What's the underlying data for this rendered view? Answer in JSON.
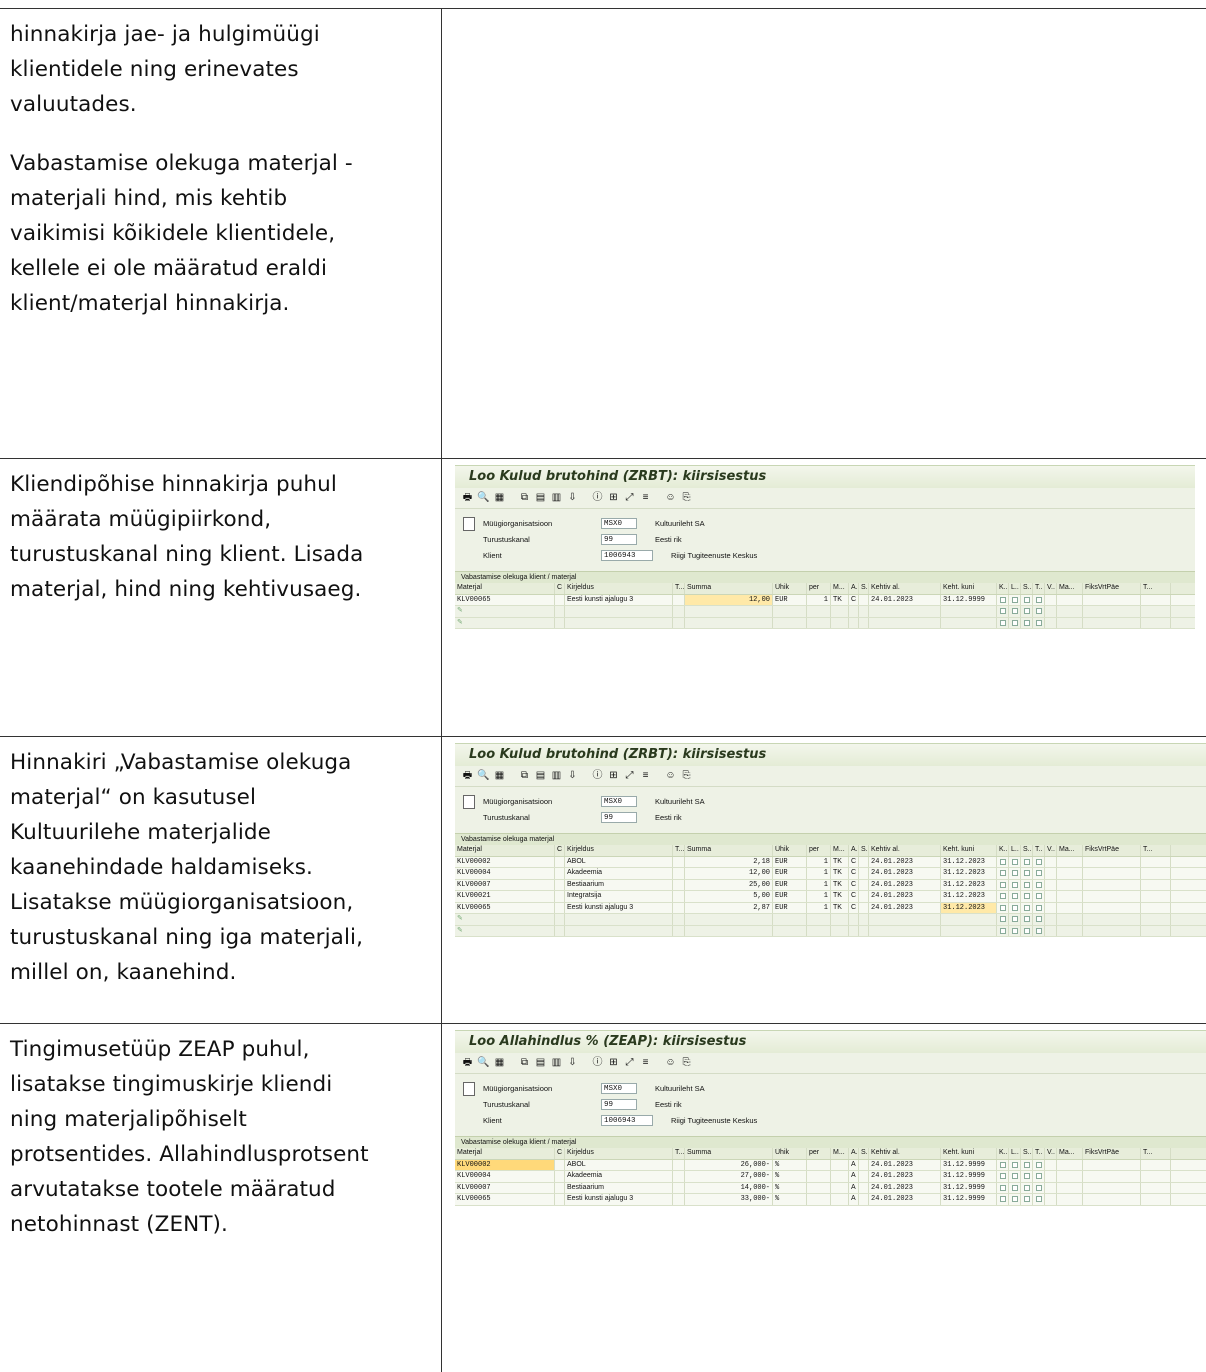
{
  "rows": [
    {
      "paragraphs": [
        [
          "hinnakirja jae- ja hulgimüügi",
          "klientidele ning erinevates",
          "valuutades."
        ],
        [
          "Vabastamise olekuga materjal -",
          "materjali hind, mis kehtib",
          "vaikimisi kõikidele klientidele,",
          "kellele ei ole määratud eraldi",
          "klient/materjal hinnakirja."
        ]
      ]
    },
    {
      "paragraphs": [
        [
          "Kliendipõhise hinnakirja puhul",
          "määrata müügipiirkond,",
          "turustuskanal ning klient. Lisada",
          "materjal, hind ning kehtivusaeg."
        ]
      ],
      "sap": {
        "title": "Loo Kulud brutohind (ZRBT): kiirsisestus",
        "header": [
          {
            "label": "Müügiorganisatsioon",
            "value": "MSX0",
            "text": "Kultuurileht SA"
          },
          {
            "label": "Turustuskanal",
            "value": "99",
            "text": "Eesti rik"
          },
          {
            "label": "Klient",
            "value": "1006943",
            "text": "Riigi Tugiteenuste Keskus"
          }
        ],
        "section": "Vabastamise olekuga klient / materjal",
        "columns": [
          "Materjal",
          "C",
          "Kirjeldus",
          "T...",
          "Summa",
          "Ühik",
          "per",
          "M...",
          "A..",
          "S..",
          "Kehtiv al.",
          "Keht. kuni",
          "K..",
          "L..",
          "S..",
          "T..",
          "V..",
          "Ma...",
          "FiksVrtPäe",
          "T..."
        ],
        "data": [
          {
            "mat": "KLV00065",
            "desc": "Eesti kunsti ajalugu 3",
            "sum": "12,00",
            "unit": "EUR",
            "per": "1",
            "m": "TK",
            "a": "C",
            "from": "24.01.2023",
            "to": "31.12.9999"
          }
        ],
        "empty_rows": 2
      }
    },
    {
      "paragraphs": [
        [
          "Hinnakiri „Vabastamise olekuga",
          "materjal“ on kasutusel",
          "Kultuurilehe materjalide",
          "kaanehindade haldamiseks.",
          "Lisatakse müügiorganisatsioon,",
          "turustuskanal ning iga materjali,",
          "millel on, kaanehind."
        ]
      ],
      "sap": {
        "title": "Loo Kulud brutohind (ZRBT): kiirsisestus",
        "header": [
          {
            "label": "Müügiorganisatsioon",
            "value": "MSX0",
            "text": "Kultuurileht SA"
          },
          {
            "label": "Turustuskanal",
            "value": "99",
            "text": "Eesti rik"
          }
        ],
        "section": "Vabastamise olekuga materjal",
        "columns": [
          "Materjal",
          "C",
          "Kirjeldus",
          "T...",
          "Summa",
          "Ühik",
          "per",
          "M...",
          "A..",
          "S..",
          "Kehtiv al.",
          "Keht. kuni",
          "K..",
          "L..",
          "S..",
          "T..",
          "V..",
          "Ma...",
          "FiksVrtPäe",
          "T..."
        ],
        "data": [
          {
            "mat": "KLV00002",
            "desc": "ABOL",
            "sum": "2,18",
            "unit": "EUR",
            "per": "1",
            "m": "TK",
            "a": "C",
            "from": "24.01.2023",
            "to": "31.12.2023"
          },
          {
            "mat": "KLV00004",
            "desc": "Akadeemia",
            "sum": "12,00",
            "unit": "EUR",
            "per": "1",
            "m": "TK",
            "a": "C",
            "from": "24.01.2023",
            "to": "31.12.2023"
          },
          {
            "mat": "KLV00007",
            "desc": "Bestiaarium",
            "sum": "25,00",
            "unit": "EUR",
            "per": "1",
            "m": "TK",
            "a": "C",
            "from": "24.01.2023",
            "to": "31.12.2023"
          },
          {
            "mat": "KLV00021",
            "desc": "Integratsija",
            "sum": "5,00",
            "unit": "EUR",
            "per": "1",
            "m": "TK",
            "a": "C",
            "from": "24.01.2023",
            "to": "31.12.2023"
          },
          {
            "mat": "KLV00065",
            "desc": "Eesti kunsti ajalugu 3",
            "sum": "2,87",
            "unit": "EUR",
            "per": "1",
            "m": "TK",
            "a": "C",
            "from": "24.01.2023",
            "to": "31.12.2023"
          }
        ],
        "empty_rows": 2
      }
    },
    {
      "paragraphs": [
        [
          "Tingimusetüüp ZEAP puhul,",
          "lisatakse tingimuskirje kliendi",
          "ning materjalipõhiselt",
          "protsentides. Allahindlusprotsent",
          "arvutatakse tootele määratud",
          "netohinnast (ZENT)."
        ]
      ],
      "sap": {
        "title": "Loo Allahindlus % (ZEAP): kiirsisestus",
        "header": [
          {
            "label": "Müügiorganisatsioon",
            "value": "MSX0",
            "text": "Kultuurileht SA"
          },
          {
            "label": "Turustuskanal",
            "value": "99",
            "text": "Eesti rik"
          },
          {
            "label": "Klient",
            "value": "1006943",
            "text": "Riigi Tugiteenuste Keskus"
          }
        ],
        "section": "Vabastamise olekuga klient / materjal",
        "columns": [
          "Materjal",
          "C",
          "Kirjeldus",
          "T...",
          "Summa",
          "Ühik",
          "per",
          "M...",
          "A..",
          "S..",
          "Kehtiv al.",
          "Keht. kuni",
          "K..",
          "L..",
          "S..",
          "T..",
          "V..",
          "Ma...",
          "FiksVrtPäe",
          "T..."
        ],
        "data": [
          {
            "mat": "KLV00002",
            "desc": "ABOL",
            "sum": "26,000-",
            "unit": "%",
            "per": "",
            "m": "",
            "a": "A",
            "from": "24.01.2023",
            "to": "31.12.9999"
          },
          {
            "mat": "KLV00004",
            "desc": "Akadeemia",
            "sum": "27,000-",
            "unit": "%",
            "per": "",
            "m": "",
            "a": "A",
            "from": "24.01.2023",
            "to": "31.12.9999"
          },
          {
            "mat": "KLV00007",
            "desc": "Bestiaarium",
            "sum": "14,000-",
            "unit": "%",
            "per": "",
            "m": "",
            "a": "A",
            "from": "24.01.2023",
            "to": "31.12.9999"
          },
          {
            "mat": "KLV00065",
            "desc": "Eesti kunsti ajalugu 3",
            "sum": "33,000-",
            "unit": "%",
            "per": "",
            "m": "",
            "a": "A",
            "from": "24.01.2023",
            "to": "31.12.9999"
          }
        ],
        "empty_rows": 0
      }
    }
  ]
}
